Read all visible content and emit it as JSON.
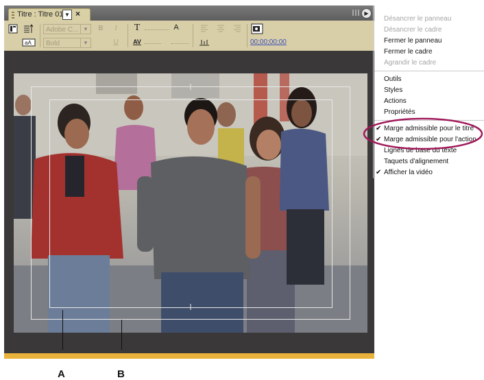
{
  "panel": {
    "tab_title": "Titre : Titre 01",
    "tab_dropdown": "▼",
    "tab_close": "×",
    "menu_button": "▶"
  },
  "toolbar": {
    "font_family": "Adobe C...",
    "font_style": "Bold",
    "bold": "B",
    "italic": "I",
    "underline": "U",
    "text_size": "T",
    "leading": "A",
    "kerning": "AV",
    "timecode": "00;00;00;00"
  },
  "menu": {
    "items_group1": [
      {
        "label": "Désancrer le panneau",
        "enabled": false
      },
      {
        "label": "Désancrer le cadre",
        "enabled": false
      },
      {
        "label": "Fermer le panneau",
        "enabled": true
      },
      {
        "label": "Fermer le cadre",
        "enabled": true
      },
      {
        "label": "Agrandir le cadre",
        "enabled": false
      }
    ],
    "items_group2": [
      {
        "label": "Outils"
      },
      {
        "label": "Styles"
      },
      {
        "label": "Actions"
      },
      {
        "label": "Propriétés"
      }
    ],
    "items_group3": [
      {
        "label": "Marge admissible pour le titre",
        "checked": true
      },
      {
        "label": "Marge admissible pour l'action",
        "checked": true
      },
      {
        "label": "Lignes de base du texte",
        "checked": false
      },
      {
        "label": "Taquets d'alignement",
        "checked": false
      },
      {
        "label": "Afficher la vidéo",
        "checked": true
      }
    ],
    "check_glyph": "✔",
    "highlight_color": "#a0185a"
  },
  "callouts": {
    "a": "A",
    "b": "B"
  },
  "colors": {
    "tab_bg": "#d9d0a6",
    "toolbar_bg": "#d8cfa8",
    "timecode": "#3a4db8",
    "bottom_bar": "#e9b23a"
  }
}
